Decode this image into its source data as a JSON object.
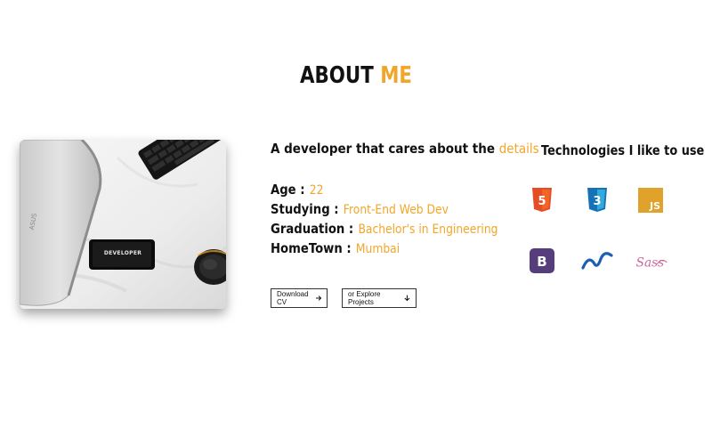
{
  "section": {
    "title_main": "ABOUT",
    "title_accent": "ME"
  },
  "photo": {
    "laptop_brand": "ASUS",
    "phone_text": "DEVELOPER"
  },
  "intro": {
    "tagline_main": "A developer that cares about the",
    "tagline_accent": "details"
  },
  "details": [
    {
      "label": "Age :",
      "value": "22"
    },
    {
      "label": "Studying :",
      "value": "Front-End Web Dev"
    },
    {
      "label": "Graduation :",
      "value": "Bachelor's in Engineering"
    },
    {
      "label": "HomeTown :",
      "value": "Mumbai"
    }
  ],
  "buttons": {
    "download_cv": "Download CV",
    "explore_projects": "or Explore Projects"
  },
  "technologies": {
    "title": "Technologies I like to use",
    "items": [
      {
        "icon": "html5-icon",
        "label": "5",
        "color": "#e44d26"
      },
      {
        "icon": "css3-icon",
        "label": "3",
        "color": "#1572b6"
      },
      {
        "icon": "javascript-icon",
        "label": "JS",
        "color": "#e0a22a"
      },
      {
        "icon": "bootstrap-icon",
        "label": "B",
        "color": "#563d7c"
      },
      {
        "icon": "tailwind-icon",
        "label": "",
        "color": "#1a5fb4"
      },
      {
        "icon": "sass-icon",
        "label": "Sass",
        "color": "#cd6799"
      }
    ]
  },
  "colors": {
    "accent": "#f2a629"
  }
}
